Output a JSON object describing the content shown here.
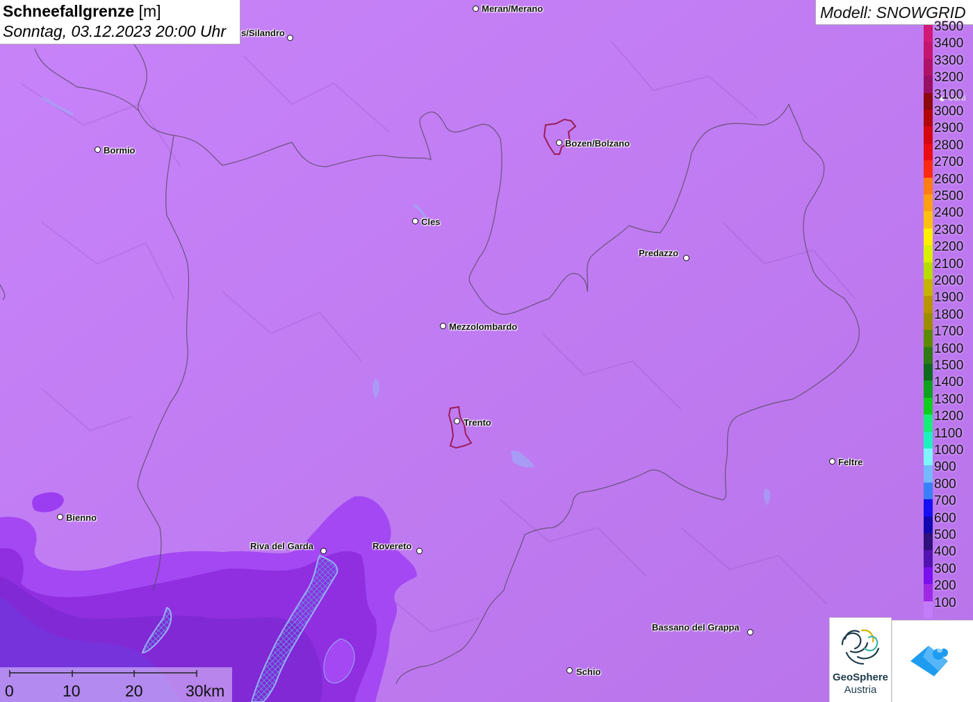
{
  "map": {
    "title_bold": "Schneefallgrenze",
    "title_unit": "[m]",
    "datetime": "Sonntag, 03.12.2023 20:00 Uhr",
    "model_label": "Modell: SNOWGRID",
    "colors": {
      "background": "#c47bf9",
      "low_zone": "#9b3df0",
      "lowest_zone": "#8a2ad6",
      "lake": "#9ab0f8",
      "border": "#555555",
      "city_outline": "#9b1c57"
    }
  },
  "places": [
    {
      "name": "Meran/Merano"
    },
    {
      "name": "s/Silandro"
    },
    {
      "name": "Bormio"
    },
    {
      "name": "Bozen/Bolzano"
    },
    {
      "name": "Cles"
    },
    {
      "name": "Predazzo"
    },
    {
      "name": "Mezzolombardo"
    },
    {
      "name": "Trento"
    },
    {
      "name": "Feltre"
    },
    {
      "name": "Bienno"
    },
    {
      "name": "Riva del Garda"
    },
    {
      "name": "Rovereto"
    },
    {
      "name": "Bassano del Grappa"
    },
    {
      "name": "Schio"
    },
    {
      "name": "Corti"
    }
  ],
  "legend": {
    "items": [
      {
        "label": "3500",
        "color": "#d11a78"
      },
      {
        "label": "3400",
        "color": "#c41670"
      },
      {
        "label": "3300",
        "color": "#b0126a"
      },
      {
        "label": "3200",
        "color": "#980f66"
      },
      {
        "label": "3100",
        "color": "#8b0a10"
      },
      {
        "label": "3000",
        "color": "#b0060c"
      },
      {
        "label": "2900",
        "color": "#d40712"
      },
      {
        "label": "2800",
        "color": "#ea0c14"
      },
      {
        "label": "2700",
        "color": "#ff2a12"
      },
      {
        "label": "2600",
        "color": "#ff7d14"
      },
      {
        "label": "2500",
        "color": "#ffa014"
      },
      {
        "label": "2400",
        "color": "#ffbf10"
      },
      {
        "label": "2300",
        "color": "#fff000"
      },
      {
        "label": "2200",
        "color": "#d9f000"
      },
      {
        "label": "2100",
        "color": "#b6dc00"
      },
      {
        "label": "2000",
        "color": "#c4b400"
      },
      {
        "label": "1900",
        "color": "#b89400"
      },
      {
        "label": "1800",
        "color": "#9c8c00"
      },
      {
        "label": "1700",
        "color": "#5c8a00"
      },
      {
        "label": "1600",
        "color": "#2f7a12"
      },
      {
        "label": "1500",
        "color": "#0f6a1e"
      },
      {
        "label": "1400",
        "color": "#10a020"
      },
      {
        "label": "1300",
        "color": "#12cc20"
      },
      {
        "label": "1200",
        "color": "#1aeb7c"
      },
      {
        "label": "1100",
        "color": "#1ef0c0"
      },
      {
        "label": "1000",
        "color": "#7ff6ff"
      },
      {
        "label": "900",
        "color": "#74b8ff"
      },
      {
        "label": "800",
        "color": "#3a80f8"
      },
      {
        "label": "700",
        "color": "#1610f2"
      },
      {
        "label": "600",
        "color": "#1208b0"
      },
      {
        "label": "500",
        "color": "#30107a"
      },
      {
        "label": "400",
        "color": "#5412b0"
      },
      {
        "label": "300",
        "color": "#7a10ec"
      },
      {
        "label": "200",
        "color": "#9e28e4"
      },
      {
        "label": "100",
        "color": "#c37cfa"
      }
    ]
  },
  "scale": {
    "labels": [
      "0",
      "10",
      "20",
      "30km"
    ]
  },
  "logos": {
    "geosphere_line1": "GeoSphere",
    "geosphere_line2": "Austria"
  }
}
